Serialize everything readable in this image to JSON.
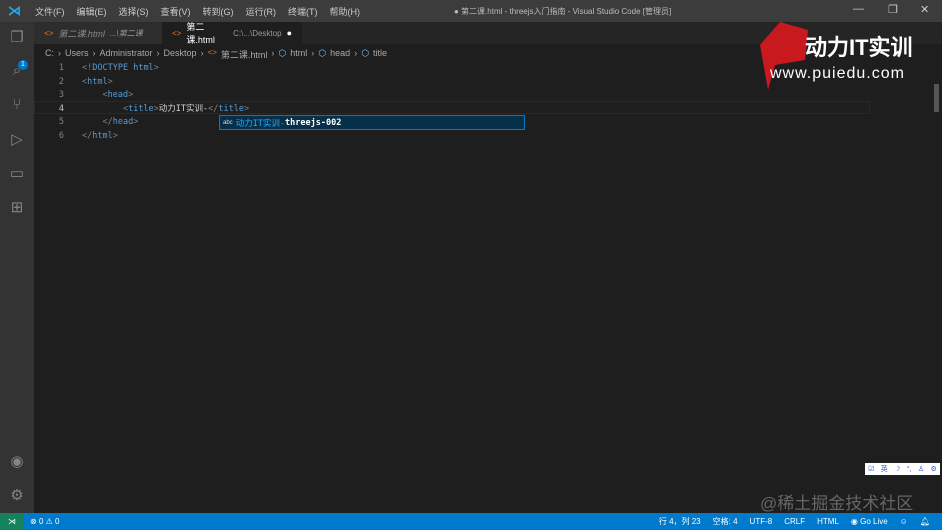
{
  "titlebar": {
    "menus": [
      "文件(F)",
      "编辑(E)",
      "选择(S)",
      "查看(V)",
      "转到(G)",
      "运行(R)",
      "终端(T)",
      "帮助(H)"
    ],
    "title": "● 第二课.html - threejs入门指南 - Visual Studio Code [管理员]"
  },
  "activity": {
    "explorer_badge": "1"
  },
  "tabs": [
    {
      "label": "第二课.html",
      "path": "...\\第二课"
    },
    {
      "label": "第二课.html",
      "path": "C:\\...\\Desktop",
      "dirty": "●"
    }
  ],
  "breadcrumb": [
    "C:",
    "Users",
    "Administrator",
    "Desktop",
    "第二课.html",
    "html",
    "head",
    "title"
  ],
  "editor": {
    "lines": [
      {
        "n": "1",
        "parts": [
          [
            "tag",
            "<!"
          ],
          [
            "tn",
            "DOCTYPE"
          ],
          [
            "tx",
            " "
          ],
          [
            "tn",
            "html"
          ],
          [
            "tag",
            ">"
          ]
        ]
      },
      {
        "n": "2",
        "parts": [
          [
            "tag",
            "<"
          ],
          [
            "tn",
            "html"
          ],
          [
            "tag",
            ">"
          ]
        ]
      },
      {
        "n": "3",
        "parts": [
          [
            "tx",
            "    "
          ],
          [
            "tag",
            "<"
          ],
          [
            "tn",
            "head"
          ],
          [
            "tag",
            ">"
          ]
        ]
      },
      {
        "n": "4",
        "parts": [
          [
            "tx",
            "        "
          ],
          [
            "tag",
            "<"
          ],
          [
            "tn",
            "title"
          ],
          [
            "tag",
            ">"
          ],
          [
            "tx",
            "动力IT实训-"
          ],
          [
            "tag",
            "</"
          ],
          [
            "tn",
            "title"
          ],
          [
            "tag",
            ">"
          ]
        ]
      },
      {
        "n": "5",
        "parts": [
          [
            "tx",
            "    "
          ],
          [
            "tag",
            "</"
          ],
          [
            "tn",
            "head"
          ],
          [
            "tag",
            ">"
          ]
        ]
      },
      {
        "n": "6",
        "parts": [
          [
            "tag",
            "</"
          ],
          [
            "tn",
            "html"
          ],
          [
            "tag",
            ">"
          ]
        ]
      }
    ]
  },
  "suggest": {
    "kind": "abc",
    "prefix": "动力IT实训-",
    "rest": "threejs-002"
  },
  "logo": {
    "name": "动力IT实训",
    "url": "www.puiedu.com"
  },
  "watermark": "@稀土掘金技术社区",
  "status": {
    "errors": "0",
    "warnings": "0",
    "position": "行 4，列 23",
    "spaces": "空格: 4",
    "encoding": "UTF-8",
    "eol": "CRLF",
    "language": "HTML",
    "golive": "Go Live"
  }
}
